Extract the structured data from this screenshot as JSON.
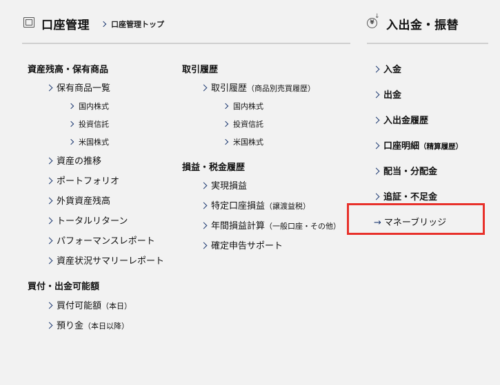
{
  "header": {
    "title": "口座管理",
    "breadcrumb": "口座管理トップ",
    "right_title": "入出金・振替",
    "yen_symbol": "¥"
  },
  "col1": {
    "assets_section": "資産残高・保有商品",
    "holdings_list": "保有商品一覧",
    "domestic_stocks": "国内株式",
    "investment_trusts": "投資信託",
    "us_stocks": "米国株式",
    "asset_trend": "資産の推移",
    "portfolio": "ポートフォリオ",
    "fx_assets": "外貨資産残高",
    "total_return": "トータルリターン",
    "performance_report": "パフォーマンスレポート",
    "asset_summary_report": "資産状況サマリーレポート",
    "buy_section": "買付・出金可能額",
    "buying_power": "買付可能額",
    "buying_power_note": "（本日）",
    "deposit": "預り金",
    "deposit_note": "（本日以降）"
  },
  "col2": {
    "history_section": "取引履歴",
    "trade_history": "取引履歴",
    "trade_history_note": "（商品別売買履歴）",
    "domestic_stocks": "国内株式",
    "investment_trusts": "投資信託",
    "us_stocks": "米国株式",
    "pl_section": "損益・税金履歴",
    "realized_pl": "実現損益",
    "specific_account_pl": "特定口座損益",
    "specific_account_note": "（譲渡益税）",
    "annual_pl": "年間損益計算",
    "annual_pl_note": "（一般口座・その他）",
    "tax_return_support": "確定申告サポート"
  },
  "col3": {
    "deposit": "入金",
    "withdraw": "出金",
    "history": "入出金履歴",
    "statement": "口座明細",
    "statement_note": "（精算履歴）",
    "dividends": "配当・分配金",
    "margin_call": "追証・不足金",
    "money_bridge": "マネーブリッジ"
  },
  "colors": {
    "highlight": "#e8302a",
    "chevron": "#1f3b73"
  }
}
